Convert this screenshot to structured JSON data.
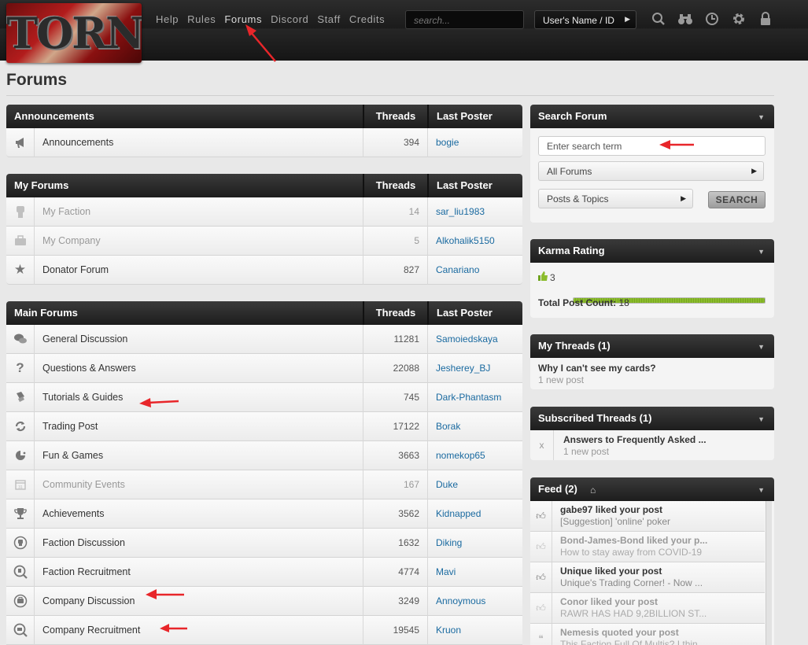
{
  "header": {
    "logo_text": "TORN",
    "nav": [
      "Help",
      "Rules",
      "Forums",
      "Discord",
      "Staff",
      "Credits"
    ],
    "search_placeholder": "search...",
    "user_button": "User's Name / ID",
    "icons": [
      "search-icon",
      "binoculars-icon",
      "clock-icon",
      "gear-icon",
      "lock-icon"
    ]
  },
  "page_title": "Forums",
  "tables": {
    "announcements": {
      "title": "Announcements",
      "threads_label": "Threads",
      "poster_label": "Last Poster",
      "rows": [
        {
          "icon": "megaphone-icon",
          "name": "Announcements",
          "threads": "394",
          "poster": "bogie"
        }
      ]
    },
    "my_forums": {
      "title": "My Forums",
      "threads_label": "Threads",
      "poster_label": "Last Poster",
      "rows": [
        {
          "icon": "fist-icon",
          "name": "My Faction",
          "threads": "14",
          "poster": "sar_liu1983",
          "dim": true
        },
        {
          "icon": "briefcase-icon",
          "name": "My Company",
          "threads": "5",
          "poster": "Alkohalik5150",
          "dim": true
        },
        {
          "icon": "star-icon",
          "name": "Donator Forum",
          "threads": "827",
          "poster": "Canariano"
        }
      ]
    },
    "main_forums": {
      "title": "Main Forums",
      "threads_label": "Threads",
      "poster_label": "Last Poster",
      "rows": [
        {
          "icon": "chat-bubbles-icon",
          "name": "General Discussion",
          "threads": "11281",
          "poster": "Samoiedskaya"
        },
        {
          "icon": "question-icon",
          "name": "Questions & Answers",
          "threads": "22088",
          "poster": "Jesherey_BJ"
        },
        {
          "icon": "guides-icon",
          "name": "Tutorials & Guides",
          "threads": "745",
          "poster": "Dark-Phantasm"
        },
        {
          "icon": "trade-arrows-icon",
          "name": "Trading Post",
          "threads": "17122",
          "poster": "Borak"
        },
        {
          "icon": "gamepad-icon",
          "name": "Fun & Games",
          "threads": "3663",
          "poster": "nomekop65"
        },
        {
          "icon": "calendar-icon",
          "name": "Community Events",
          "threads": "167",
          "poster": "Duke",
          "dim": true
        },
        {
          "icon": "trophy-icon",
          "name": "Achievements",
          "threads": "3562",
          "poster": "Kidnapped"
        },
        {
          "icon": "faction-chat-icon",
          "name": "Faction Discussion",
          "threads": "1632",
          "poster": "Diking"
        },
        {
          "icon": "faction-search-icon",
          "name": "Faction Recruitment",
          "threads": "4774",
          "poster": "Mavi"
        },
        {
          "icon": "company-chat-icon",
          "name": "Company Discussion",
          "threads": "3249",
          "poster": "Annoymous"
        },
        {
          "icon": "company-search-icon",
          "name": "Company Recruitment",
          "threads": "19545",
          "poster": "Kruon"
        }
      ]
    }
  },
  "sidebar": {
    "search": {
      "title": "Search Forum",
      "input_placeholder": "Enter search term",
      "scope": "All Forums",
      "type": "Posts & Topics",
      "button": "SEARCH"
    },
    "karma": {
      "title": "Karma Rating",
      "value": "3",
      "bar_fill": 1.0,
      "post_count_label": "Total Post Count:",
      "post_count": "18"
    },
    "my_threads": {
      "title": "My Threads (1)",
      "items": [
        {
          "title": "Why I can't see my cards?",
          "sub": "1 new post"
        }
      ]
    },
    "subscribed": {
      "title": "Subscribed Threads (1)",
      "items": [
        {
          "icon": "x",
          "title": "Answers to Frequently Asked ...",
          "sub": "1 new post"
        }
      ]
    },
    "feed": {
      "title": "Feed (2)",
      "items": [
        {
          "title": "gabe97 liked your post",
          "sub": "[Suggestion] 'online' poker",
          "dim": false,
          "icon": "thumbs-up-icon"
        },
        {
          "title": "Bond-James-Bond liked your p...",
          "sub": "How to stay away from COVID-19",
          "dim": true,
          "icon": "thumbs-up-icon"
        },
        {
          "title": "Unique liked your post",
          "sub": "Unique's Trading Corner! - Now ...",
          "dim": false,
          "icon": "thumbs-up-icon"
        },
        {
          "title": "Conor liked your post",
          "sub": "RAWR HAS HAD 9,2BILLION ST...",
          "dim": true,
          "icon": "thumbs-up-icon"
        },
        {
          "title": "Nemesis quoted your post",
          "sub": "This Faction Full Of Multis? I thin",
          "dim": true,
          "icon": "quote-icon"
        }
      ]
    }
  },
  "colors": {
    "link": "#1a6aa0",
    "header_bg": "#1d1d1d",
    "karma_green": "#8bbc2c",
    "annotation_red": "#e8262a"
  }
}
